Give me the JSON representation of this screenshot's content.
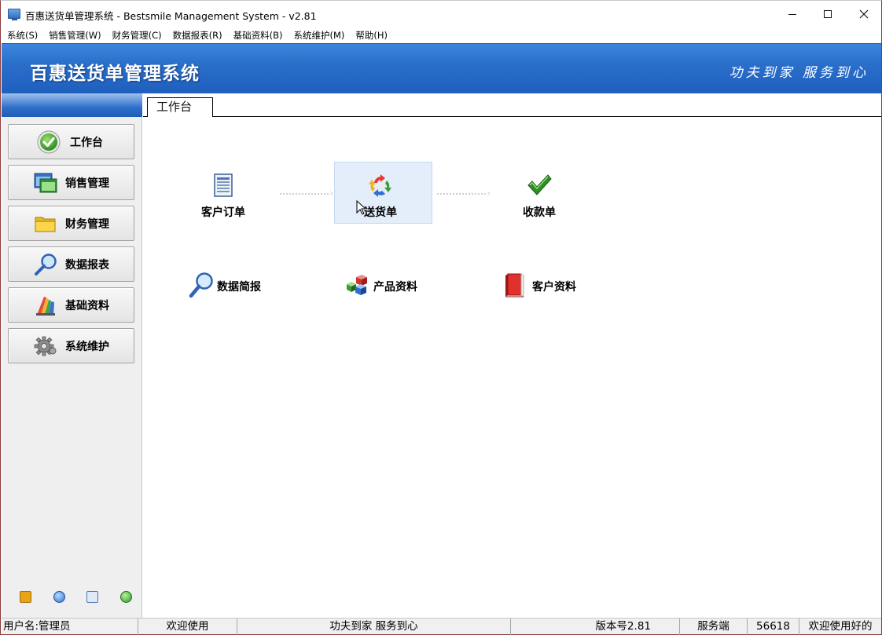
{
  "window": {
    "title": "百惠送货单管理系统 - Bestsmile Management System - v2.81"
  },
  "menu": [
    {
      "label": "系统(S)"
    },
    {
      "label": "销售管理(W)"
    },
    {
      "label": "财务管理(C)"
    },
    {
      "label": "数据报表(R)"
    },
    {
      "label": "基础资料(B)"
    },
    {
      "label": "系统维护(M)"
    },
    {
      "label": "帮助(H)"
    }
  ],
  "banner": {
    "app_name": "百惠送货单管理系统",
    "slogan": "功夫到家 服务到心"
  },
  "sidebar": {
    "items": [
      {
        "label": "工作台",
        "icon": "check-circle-icon"
      },
      {
        "label": "销售管理",
        "icon": "window-icon"
      },
      {
        "label": "财务管理",
        "icon": "folder-icon"
      },
      {
        "label": "数据报表",
        "icon": "magnifier-icon"
      },
      {
        "label": "基础资料",
        "icon": "palette-icon"
      },
      {
        "label": "系统维护",
        "icon": "gear-icon"
      }
    ],
    "bottom_icons": [
      "key-icon",
      "clock-icon",
      "search-window-icon",
      "back-arrow-icon"
    ]
  },
  "workspace": {
    "tab_label": "工作台",
    "flow": [
      {
        "label": "客户订单",
        "icon": "document-icon"
      },
      {
        "label": "送货单",
        "icon": "refresh-arrows-icon"
      },
      {
        "label": "收款单",
        "icon": "checkmark-icon"
      }
    ],
    "shortcuts": [
      {
        "label": "数据简报",
        "icon": "magnifier-icon"
      },
      {
        "label": "产品资料",
        "icon": "cubes-icon"
      },
      {
        "label": "客户资料",
        "icon": "red-book-icon"
      }
    ]
  },
  "status_bar": {
    "user": "用户名:管理员",
    "welcome": "欢迎使用",
    "slogan": "功夫到家 服务到心",
    "version": "版本号2.81",
    "server": "服务端",
    "port": "56618",
    "greeting": "欢迎使用好的"
  }
}
